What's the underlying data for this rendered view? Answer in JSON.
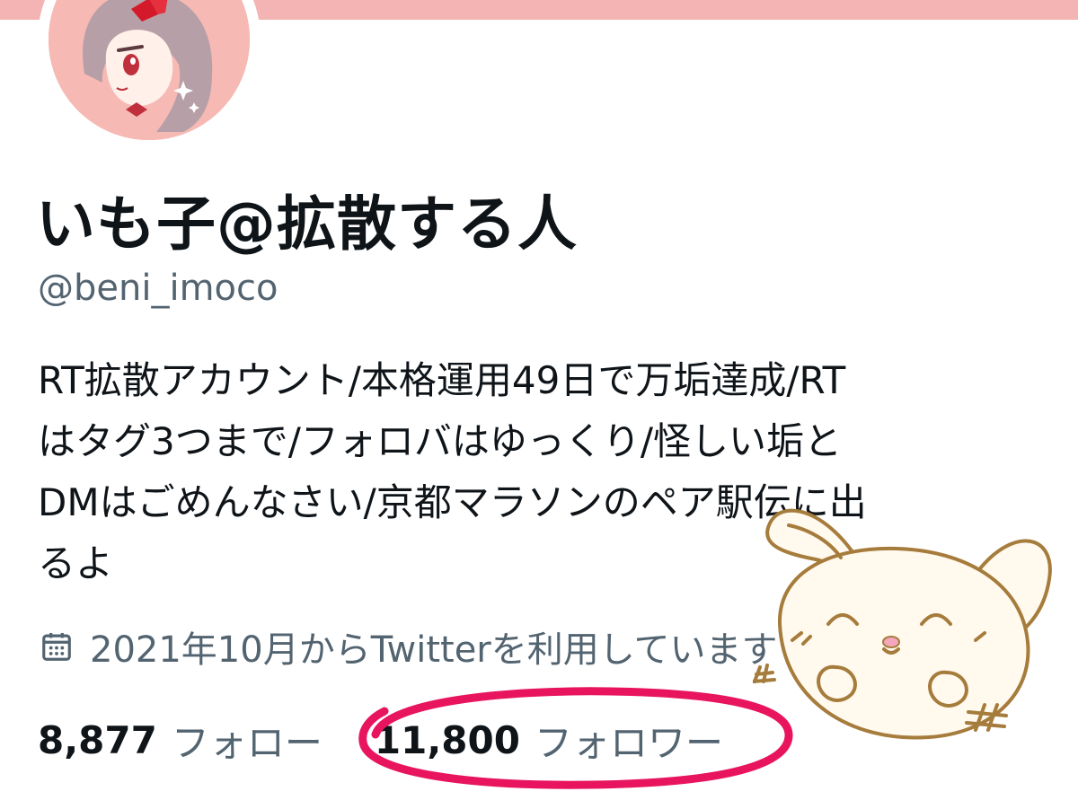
{
  "profile": {
    "display_name": "いも子@拡散する人",
    "handle": "@beni_imoco",
    "bio_lines": [
      "RT拡散アカウント/本格運用49日で万垢達成/RT",
      "はタグ3つまで/フォロバはゆっくり/怪しい垢と",
      "DMはごめんなさい/京都マラソンのペア駅伝に出",
      "るよ"
    ],
    "joined": "2021年10月からTwitterを利用しています",
    "avatar_icon": "anime-girl-avatar"
  },
  "stats": {
    "following_count": "8,877",
    "following_label": "フォロー",
    "followers_count": "11,800",
    "followers_label": "フォロワー"
  },
  "colors": {
    "banner": "#f5b4b4",
    "avatar_bg": "#f6b9b4",
    "text_primary": "#0f1419",
    "text_secondary": "#536471",
    "highlight": "#e8155e",
    "sticker_line": "#a67c3c",
    "sticker_fill": "#fff9ee",
    "sticker_blush": "#f4a6bd"
  },
  "icons": {
    "calendar": "calendar-icon",
    "sticker": "bunny-sticker",
    "highlight": "highlight-ellipse"
  }
}
